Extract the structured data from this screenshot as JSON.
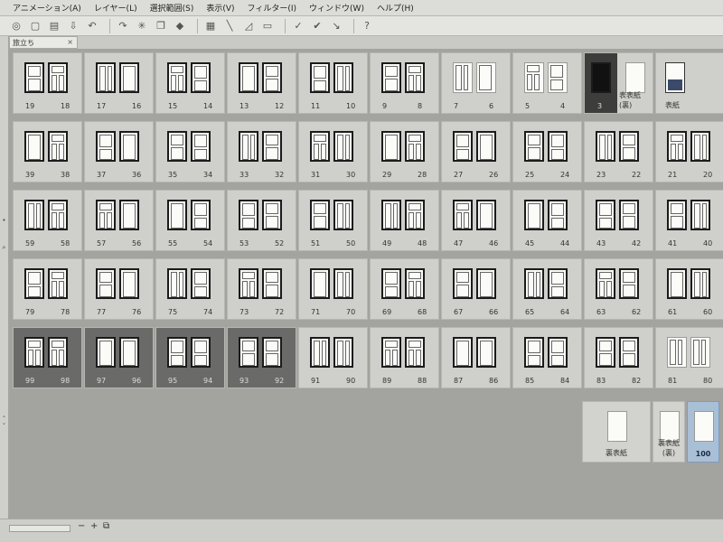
{
  "menu": [
    "アニメーション(A)",
    "レイヤー(L)",
    "選択範囲(S)",
    "表示(V)",
    "フィルター(I)",
    "ウィンドウ(W)",
    "ヘルプ(H)"
  ],
  "toolbar_icons": [
    "app-icon",
    "new-icon",
    "open-icon",
    "save-icon",
    "undo-icon",
    "redo-icon",
    "loading-icon",
    "copy-icon",
    "fill-icon",
    "grid-icon",
    "ruler-icon",
    "perspective-icon",
    "frame-icon",
    "check-icon",
    "check-all-icon",
    "check-arrow-icon",
    "help-icon"
  ],
  "tab": {
    "label": "旅立ち",
    "close": "×"
  },
  "status": {
    "minus": "−",
    "plus": "+",
    "fit": "⧉"
  },
  "rows": [
    [
      {
        "left": "19",
        "right": "18"
      },
      {
        "left": "17",
        "right": "16"
      },
      {
        "left": "15",
        "right": "14"
      },
      {
        "left": "13",
        "right": "12"
      },
      {
        "left": "11",
        "right": "10"
      },
      {
        "left": "9",
        "right": "8"
      },
      {
        "left": "7",
        "right": "6",
        "style": "light"
      },
      {
        "left": "5",
        "right": "4",
        "style": "light"
      },
      {
        "left": "3",
        "right": "表表紙(裏)",
        "style": "special"
      },
      {
        "left": "",
        "right": "表紙",
        "style": "cover"
      }
    ],
    [
      {
        "left": "39",
        "right": "38"
      },
      {
        "left": "37",
        "right": "36"
      },
      {
        "left": "35",
        "right": "34"
      },
      {
        "left": "33",
        "right": "32"
      },
      {
        "left": "31",
        "right": "30"
      },
      {
        "left": "29",
        "right": "28"
      },
      {
        "left": "27",
        "right": "26"
      },
      {
        "left": "25",
        "right": "24"
      },
      {
        "left": "23",
        "right": "22"
      },
      {
        "left": "21",
        "right": "20"
      }
    ],
    [
      {
        "left": "59",
        "right": "58"
      },
      {
        "left": "57",
        "right": "56"
      },
      {
        "left": "55",
        "right": "54"
      },
      {
        "left": "53",
        "right": "52"
      },
      {
        "left": "51",
        "right": "50"
      },
      {
        "left": "49",
        "right": "48"
      },
      {
        "left": "47",
        "right": "46"
      },
      {
        "left": "45",
        "right": "44"
      },
      {
        "left": "43",
        "right": "42"
      },
      {
        "left": "41",
        "right": "40"
      }
    ],
    [
      {
        "left": "79",
        "right": "78"
      },
      {
        "left": "77",
        "right": "76"
      },
      {
        "left": "75",
        "right": "74"
      },
      {
        "left": "73",
        "right": "72"
      },
      {
        "left": "71",
        "right": "70"
      },
      {
        "left": "69",
        "right": "68"
      },
      {
        "left": "67",
        "right": "66"
      },
      {
        "left": "65",
        "right": "64"
      },
      {
        "left": "63",
        "right": "62"
      },
      {
        "left": "61",
        "right": "60"
      }
    ],
    [
      {
        "left": "99",
        "right": "98",
        "style": "dark"
      },
      {
        "left": "97",
        "right": "96",
        "style": "dark"
      },
      {
        "left": "95",
        "right": "94",
        "style": "dark"
      },
      {
        "left": "93",
        "right": "92",
        "style": "dark"
      },
      {
        "left": "91",
        "right": "90"
      },
      {
        "left": "89",
        "right": "88"
      },
      {
        "left": "87",
        "right": "86"
      },
      {
        "left": "85",
        "right": "84"
      },
      {
        "left": "83",
        "right": "82"
      },
      {
        "left": "81",
        "right": "80",
        "style": "light"
      }
    ]
  ],
  "back_covers": [
    {
      "label": "裏表紙"
    },
    {
      "label": "裏表紙(裏)"
    },
    {
      "label": "100",
      "active": true
    }
  ]
}
